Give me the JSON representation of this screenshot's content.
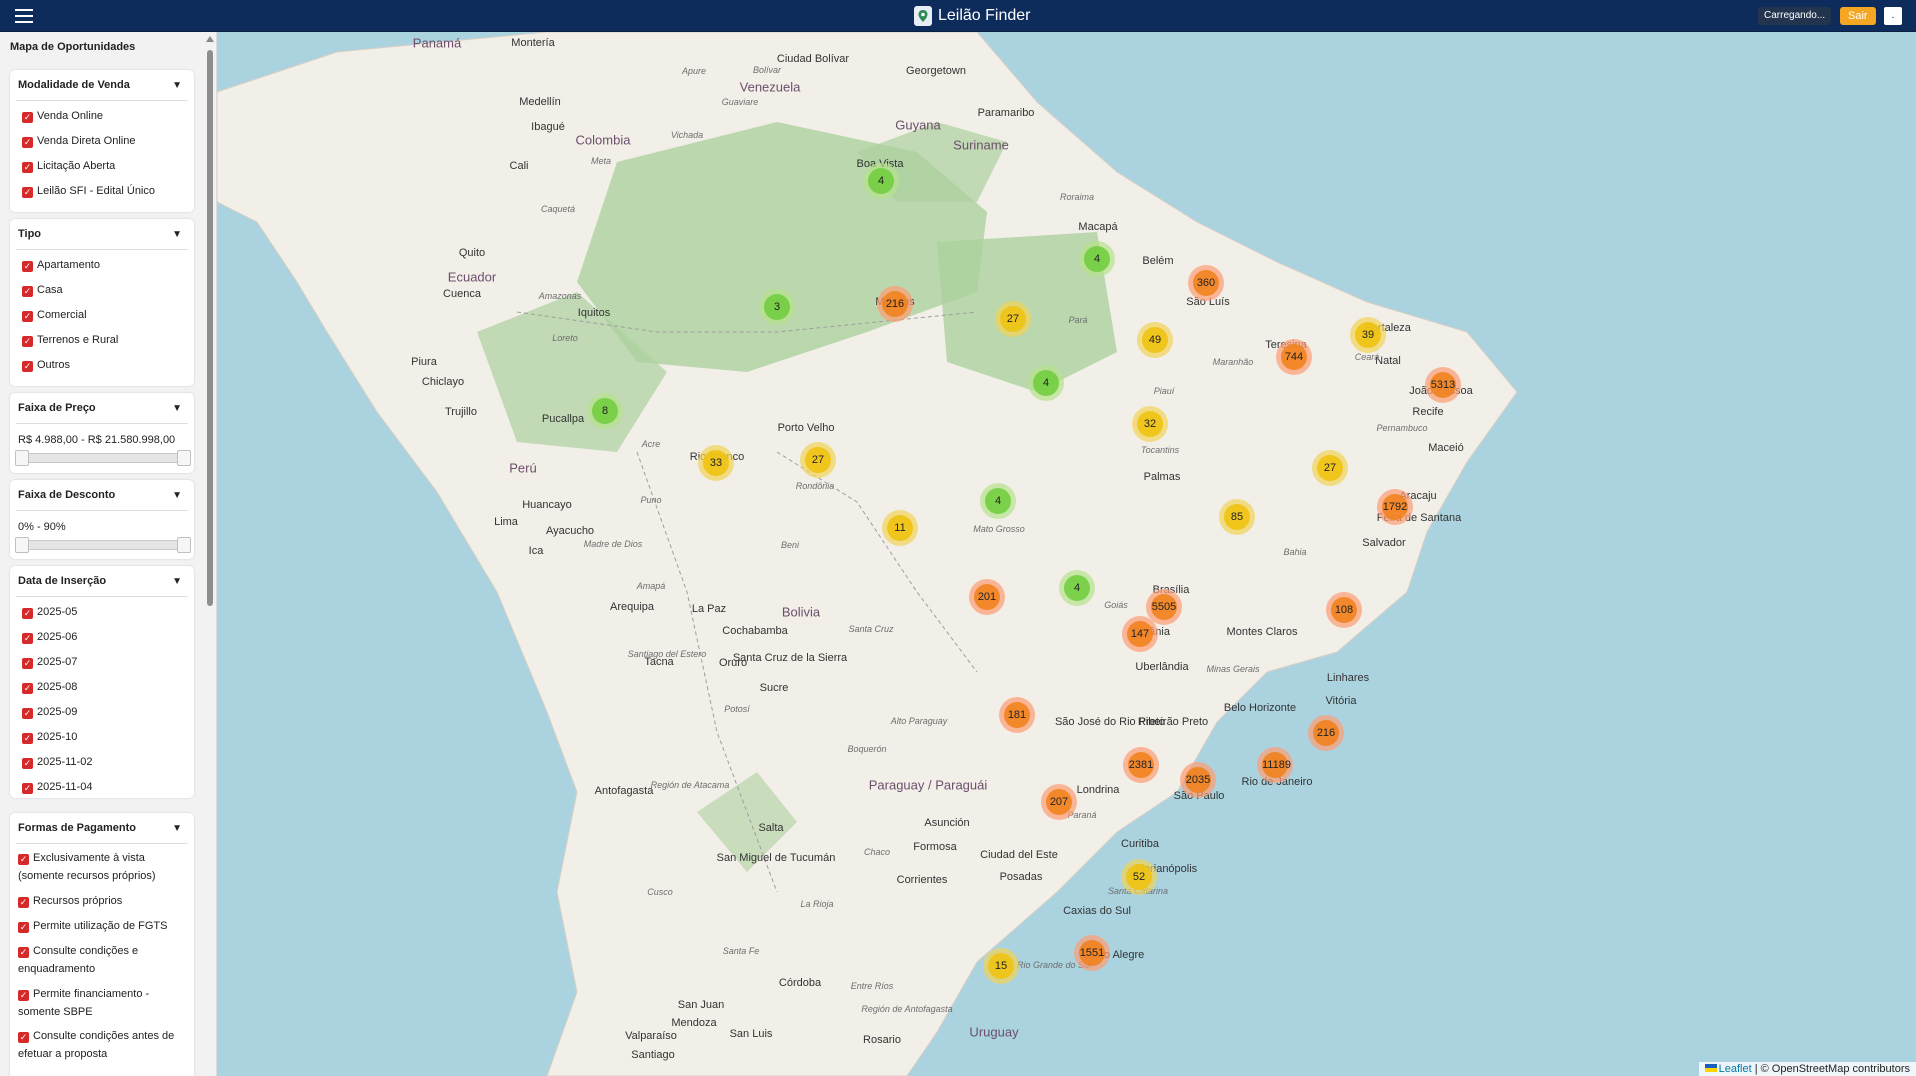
{
  "header": {
    "brand": "Leilão Finder",
    "status": "Carregando...",
    "logout": "Sair",
    "more": "."
  },
  "sidebar": {
    "title": "Mapa de Oportunidades",
    "modalidade": {
      "title": "Modalidade de Venda",
      "options": [
        "Venda Online",
        "Venda Direta Online",
        "Licitação Aberta",
        "Leilão SFI - Edital Único"
      ]
    },
    "tipo": {
      "title": "Tipo",
      "options": [
        "Apartamento",
        "Casa",
        "Comercial",
        "Terrenos e Rural",
        "Outros"
      ]
    },
    "preco": {
      "title": "Faixa de Preço",
      "range": "R$ 4.988,00 - R$ 21.580.998,00"
    },
    "desconto": {
      "title": "Faixa de Desconto",
      "range": "0% - 90%"
    },
    "data": {
      "title": "Data de Inserção",
      "options": [
        "2025-05",
        "2025-06",
        "2025-07",
        "2025-08",
        "2025-09",
        "2025-10",
        "2025-11-02",
        "2025-11-04"
      ]
    },
    "pagamento": {
      "title": "Formas de Pagamento",
      "options": [
        "Exclusivamente à vista (somente recursos próprios)",
        "Recursos próprios",
        "Permite utilização de FGTS",
        "Consulte condições e enquadramento",
        "Permite financiamento - somente SBPE",
        "Consulte condições antes de efetuar a proposta"
      ]
    },
    "chevron": "▼",
    "check": "✓"
  },
  "map": {
    "zoom_in": "+",
    "zoom_out": "−",
    "attribution_link": "Leaflet",
    "attribution_text": " | © OpenStreetMap contributors",
    "clusters": [
      "4",
      "4",
      "3",
      "216",
      "27",
      "360",
      "49",
      "39",
      "744",
      "5313",
      "8",
      "4",
      "32",
      "33",
      "27",
      "27",
      "11",
      "4",
      "85",
      "1792",
      "201",
      "4",
      "5505",
      "147",
      "108",
      "181",
      "216",
      "2381",
      "2035",
      "11189",
      "207",
      "52",
      "1551",
      "15"
    ],
    "labels": [
      "Panamá",
      "Montería",
      "Ciudad Bolívar",
      "Georgetown",
      "Venezuela",
      "Medellín",
      "Colombia",
      "Guyana",
      "Paramaribo",
      "Suriname",
      "Ibagué",
      "Boa Vista",
      "Cali",
      "Quito",
      "Ecuador",
      "Cuenca",
      "Macapá",
      "Belém",
      "São Luís",
      "Iquitos",
      "Manaus",
      "Teresina",
      "Natal",
      "Fortaleza",
      "João Pessoa",
      "Recife",
      "Piura",
      "Chiclayo",
      "Trujillo",
      "Pucallpa",
      "Porto Velho",
      "Maceió",
      "Palmas",
      "Aracaju",
      "Perú",
      "Rio Branco",
      "Huancayo",
      "Lima",
      "Ayacucho",
      "Ica",
      "Feira de Santana",
      "Salvador",
      "Brasília",
      "Goiânia",
      "Montes Claros",
      "Uberlândia",
      "Arequipa",
      "La Paz",
      "Bolivia",
      "Cochabamba",
      "Santa Cruz de la Sierra",
      "Tacna",
      "Oruro",
      "Sucre",
      "Linhares",
      "Vitória",
      "Belo Horizonte",
      "São José do Rio Preto",
      "Ribeirão Preto",
      "São Paulo",
      "Rio de Janeiro",
      "Londrina",
      "Antofagasta",
      "Paraguay / Paraguái",
      "Asunción",
      "Salta",
      "Formosa",
      "Ciudad del Este",
      "San Miguel de Tucumán",
      "Corrientes",
      "Posadas",
      "Curitiba",
      "Florianópolis",
      "Caxias do Sul",
      "Porto Alegre",
      "Córdoba",
      "San Juan",
      "Mendoza",
      "San Luis",
      "Valparaíso",
      "Santiago",
      "Rosario",
      "Uruguay",
      "Amazonas",
      "Meta",
      "Caquetá",
      "Vichada",
      "Guaviare",
      "Apure",
      "Bolívar",
      "Loreto",
      "Acre",
      "Rondônia",
      "Pará",
      "Maranhão",
      "Piauí",
      "Ceará",
      "Pernambuco",
      "Bahia",
      "Tocantins",
      "Mato Grosso",
      "Goiás",
      "Minas Gerais",
      "Paraná",
      "Rio Grande do Sul",
      "Santa Catarina",
      "Beni",
      "Santa Cruz",
      "Potosí",
      "Alto Paraguay",
      "Boquerón",
      "Chaco",
      "Santiago del Estero",
      "La Rioja",
      "Santa Fe",
      "Entre Ríos",
      "Región de Antofagasta",
      "Región de Atacama",
      "Cusco",
      "Madre de Dios",
      "Puno",
      "Amapá",
      "Roraima"
    ]
  }
}
